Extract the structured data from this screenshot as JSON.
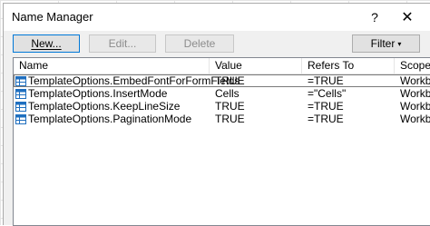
{
  "dialog": {
    "title": "Name Manager",
    "help_label": "?",
    "close_label": "✕"
  },
  "toolbar": {
    "new_label": "New...",
    "edit_label": "Edit...",
    "delete_label": "Delete",
    "filter_label": "Filter",
    "filter_caret": "▾"
  },
  "list": {
    "columns": [
      "Name",
      "Value",
      "Refers To",
      "Scope"
    ],
    "rows": [
      {
        "name": "TemplateOptions.EmbedFontForFormFields",
        "value": "TRUE",
        "refers_to": "=TRUE",
        "scope": "Workb"
      },
      {
        "name": "TemplateOptions.InsertMode",
        "value": "Cells",
        "refers_to": "=\"Cells\"",
        "scope": "Workb"
      },
      {
        "name": "TemplateOptions.KeepLineSize",
        "value": "TRUE",
        "refers_to": "=TRUE",
        "scope": "Workb"
      },
      {
        "name": "TemplateOptions.PaginationMode",
        "value": "TRUE",
        "refers_to": "=TRUE",
        "scope": "Workb"
      }
    ],
    "row_icon": "named-range-table-icon"
  },
  "colors": {
    "icon_blue": "#1f6fbf",
    "default_button_border": "#0078d7"
  }
}
